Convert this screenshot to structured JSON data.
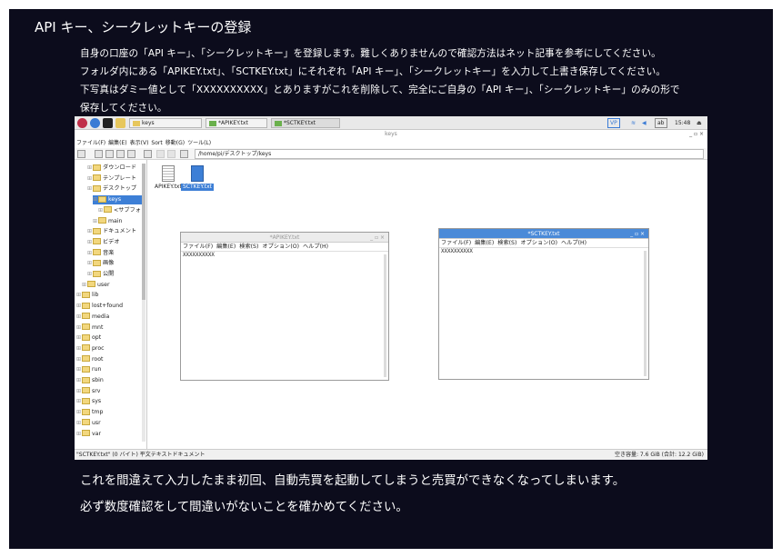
{
  "slide": {
    "title": "API キー、シークレットキーの登録",
    "intro": [
      "自身の口座の「API キー」、「シークレットキー」を登録します。難しくありませんので確認方法はネット記事を参考にしてください。",
      "フォルダ内にある「APIKEY.txt」、「SCTKEY.txt」にそれぞれ「API キー」、「シークレットキー」を入力して上書き保存してください。",
      "下写真はダミー値として「XXXXXXXXXX」とありますがこれを削除して、完全にご自身の「API キー」、「シークレットキー」のみの形で",
      "保存してください。"
    ],
    "outro": [
      "これを間違えて入力したまま初回、自動売買を起動してしまうと売買ができなくなってしまいます。",
      "必ず数度確認をして間違いがないことを確かめてください。"
    ]
  },
  "taskbar": {
    "tasks": [
      "keys",
      "*APIKEY.txt",
      "*SCTKEY.txt"
    ],
    "tray_badge": "VP",
    "tray_kb": "ab",
    "clock": "15:48"
  },
  "filemanager": {
    "title": "keys",
    "window_buttons": "_ ▫ ×",
    "menu": [
      "ファイル(F)",
      "編集(E)",
      "表示(V)",
      "Sort",
      "移動(G)",
      "ツール(L)"
    ],
    "address": "/home/pi/デスクトップ/keys",
    "sidebar": {
      "items": [
        {
          "label": "ダウンロード",
          "indent": 2
        },
        {
          "label": "テンプレート",
          "indent": 2
        },
        {
          "label": "デスクトップ",
          "indent": 2
        },
        {
          "label": "keys",
          "indent": 3,
          "selected": true
        },
        {
          "label": "<サブフォ",
          "indent": 4
        },
        {
          "label": "main",
          "indent": 3
        },
        {
          "label": "ドキュメント",
          "indent": 2
        },
        {
          "label": "ビデオ",
          "indent": 2
        },
        {
          "label": "音楽",
          "indent": 2
        },
        {
          "label": "画像",
          "indent": 2
        },
        {
          "label": "公開",
          "indent": 2
        },
        {
          "label": "user",
          "indent": 1
        },
        {
          "label": "lib",
          "indent": 0
        },
        {
          "label": "lost+found",
          "indent": 0
        },
        {
          "label": "media",
          "indent": 0
        },
        {
          "label": "mnt",
          "indent": 0
        },
        {
          "label": "opt",
          "indent": 0
        },
        {
          "label": "proc",
          "indent": 0
        },
        {
          "label": "root",
          "indent": 0
        },
        {
          "label": "run",
          "indent": 0
        },
        {
          "label": "sbin",
          "indent": 0
        },
        {
          "label": "srv",
          "indent": 0
        },
        {
          "label": "sys",
          "indent": 0
        },
        {
          "label": "tmp",
          "indent": 0
        },
        {
          "label": "usr",
          "indent": 0
        },
        {
          "label": "var",
          "indent": 0
        }
      ]
    },
    "files": [
      {
        "name": "APIKEY.txt",
        "selected": false
      },
      {
        "name": "SCTKEY.txt",
        "selected": true
      }
    ],
    "status_left": "\"SCTKEY.txt\" (0 バイト) 平文テキストドキュメント",
    "status_right": "空き容量: 7.6 GiB (合計: 12.2 GiB)"
  },
  "editors": [
    {
      "title": "*APIKEY.txt",
      "buttons": "_ ▫ ×",
      "menu": [
        "ファイル(F)",
        "編集(E)",
        "検索(S)",
        "オプション(O)",
        "ヘルプ(H)"
      ],
      "content": "XXXXXXXXXX"
    },
    {
      "title": "*SCTKEY.txt",
      "buttons": "_ ▫ ×",
      "menu": [
        "ファイル(F)",
        "編集(E)",
        "検索(S)",
        "オプション(O)",
        "ヘルプ(H)"
      ],
      "content": "XXXXXXXXXX"
    }
  ]
}
